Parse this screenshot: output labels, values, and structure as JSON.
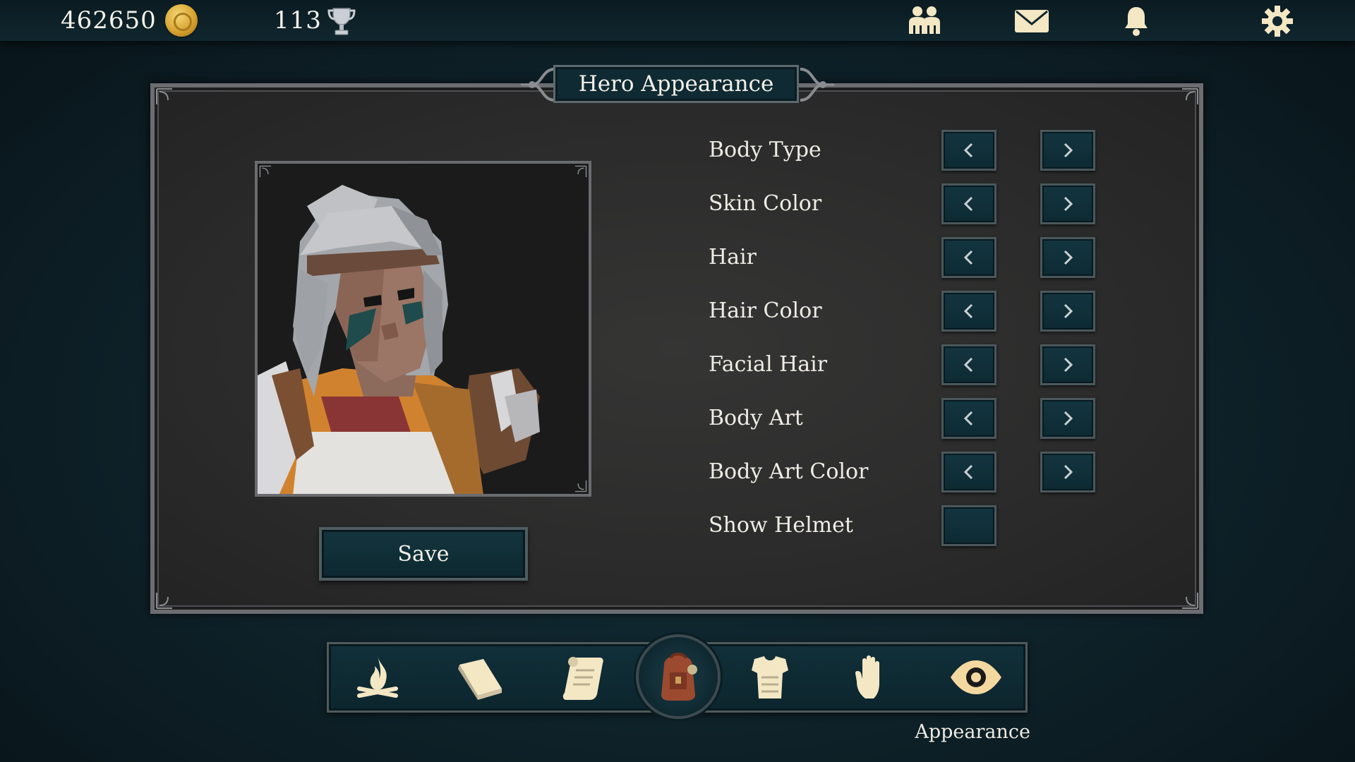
{
  "top_bar": {
    "coins": "462650",
    "trophies": "113",
    "icons": [
      "friends-icon",
      "mail-icon",
      "bell-icon",
      "gear-icon"
    ]
  },
  "panel": {
    "title": "Hero Appearance",
    "save_label": "Save"
  },
  "options": [
    {
      "label": "Body Type",
      "type": "cycle"
    },
    {
      "label": "Skin Color",
      "type": "cycle"
    },
    {
      "label": "Hair",
      "type": "cycle"
    },
    {
      "label": "Hair Color",
      "type": "cycle"
    },
    {
      "label": "Facial Hair",
      "type": "cycle"
    },
    {
      "label": "Body Art",
      "type": "cycle"
    },
    {
      "label": "Body Art Color",
      "type": "cycle"
    },
    {
      "label": "Show Helmet",
      "type": "toggle",
      "checked": false
    }
  ],
  "bottom_nav": {
    "items": [
      "campfire-icon",
      "book-icon",
      "scroll-icon",
      "backpack-icon",
      "armor-icon",
      "hand-icon",
      "eye-icon"
    ],
    "active": "backpack-icon",
    "caption": "Appearance"
  },
  "colors": {
    "accent_teal": "#0f2a32",
    "icon_cream": "#f3e7c4",
    "coin_gold": "#d7a431"
  }
}
